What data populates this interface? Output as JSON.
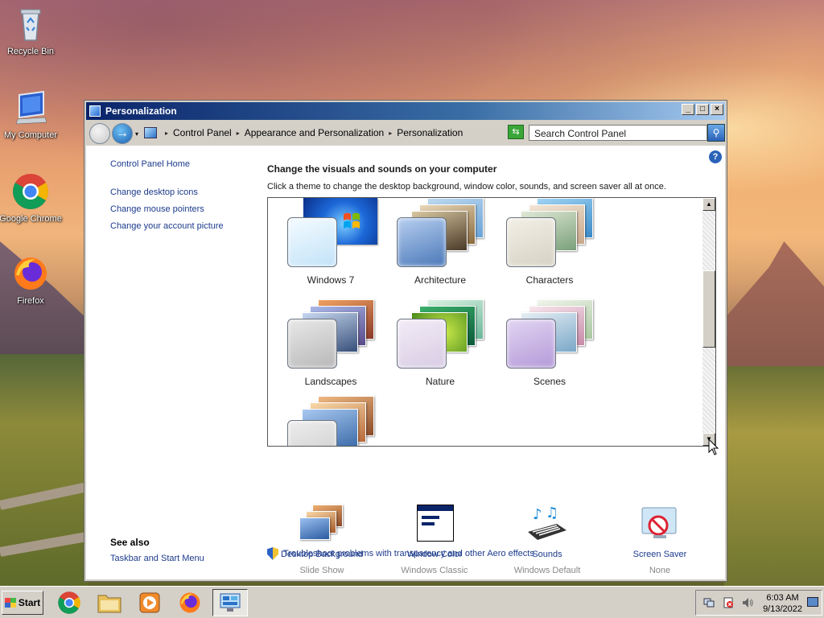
{
  "desktop": {
    "icons": [
      {
        "label": "Recycle Bin"
      },
      {
        "label": "My Computer"
      },
      {
        "label": "Google Chrome"
      },
      {
        "label": "Firefox"
      }
    ]
  },
  "window": {
    "title": "Personalization",
    "controls": {
      "minimize": "_",
      "maximize": "□",
      "close": "×"
    },
    "breadcrumb": [
      "Control Panel",
      "Appearance and Personalization",
      "Personalization"
    ],
    "search_placeholder": "Search Control Panel"
  },
  "sidebar": {
    "home": "Control Panel Home",
    "links": [
      "Change desktop icons",
      "Change mouse pointers",
      "Change your account picture"
    ],
    "see_also_title": "See also",
    "see_also_links": [
      "Taskbar and Start Menu"
    ]
  },
  "main": {
    "title": "Change the visuals and sounds on your computer",
    "description": "Click a theme to change the desktop background, window color, sounds, and screen saver all at once.",
    "themes": [
      "Windows 7",
      "Architecture",
      "Characters",
      "Landscapes",
      "Nature",
      "Scenes"
    ],
    "bottom_items": [
      {
        "label": "Desktop Background",
        "sub": "Slide Show",
        "icon": "desktop-background-icon"
      },
      {
        "label": "Window Color",
        "sub": "Windows Classic",
        "icon": "window-color-icon"
      },
      {
        "label": "Sounds",
        "sub": "Windows Default",
        "icon": "sounds-icon"
      },
      {
        "label": "Screen Saver",
        "sub": "None",
        "icon": "screen-saver-icon"
      }
    ],
    "troubleshoot": "Troubleshoot problems with transparency and other Aero effects"
  },
  "taskbar": {
    "start_label": "Start",
    "clock_time": "6:03 AM",
    "clock_date": "9/13/2022"
  }
}
